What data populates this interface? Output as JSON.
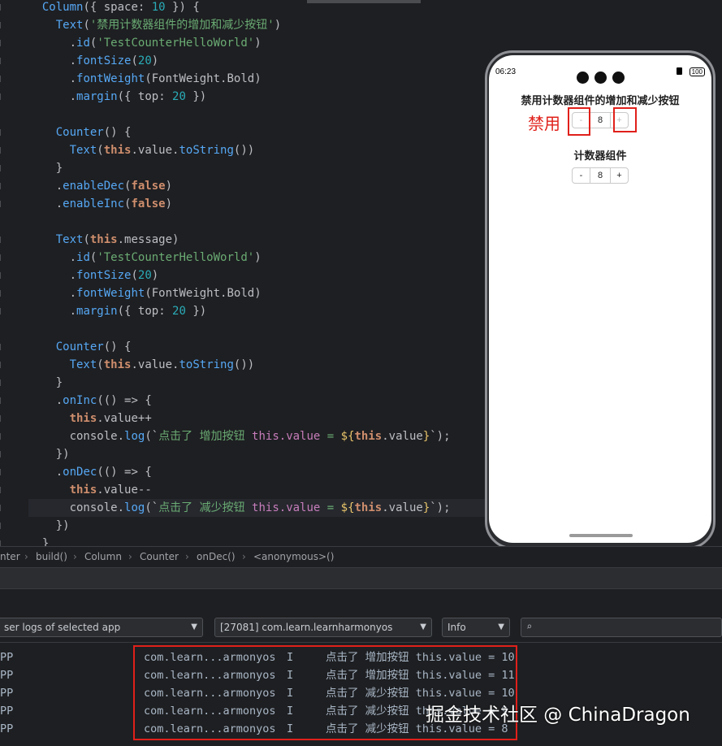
{
  "editor": {
    "lines": [
      {
        "tokens": [
          [
            "Column",
            "t-comp"
          ],
          [
            "({ ",
            "t-pn"
          ],
          [
            "space",
            "t-plain"
          ],
          [
            ": ",
            "t-pn"
          ],
          [
            "10",
            "t-num"
          ],
          [
            " }) {",
            "t-pn"
          ]
        ],
        "indent": "  "
      },
      {
        "tokens": [
          [
            "Text",
            "t-comp"
          ],
          [
            "(",
            "t-pn"
          ],
          [
            "'禁用计数器组件的增加和减少按钮'",
            "t-str"
          ],
          [
            ")",
            "t-pn"
          ]
        ],
        "indent": "    "
      },
      {
        "tokens": [
          [
            ".",
            "t-pn"
          ],
          [
            "id",
            "t-fn"
          ],
          [
            "(",
            "t-pn"
          ],
          [
            "'TestCounterHelloWorld'",
            "t-str"
          ],
          [
            ")",
            "t-pn"
          ]
        ],
        "indent": "      "
      },
      {
        "tokens": [
          [
            ".",
            "t-pn"
          ],
          [
            "fontSize",
            "t-fn"
          ],
          [
            "(",
            "t-pn"
          ],
          [
            "20",
            "t-num"
          ],
          [
            ")",
            "t-pn"
          ]
        ],
        "indent": "      "
      },
      {
        "tokens": [
          [
            ".",
            "t-pn"
          ],
          [
            "fontWeight",
            "t-fn"
          ],
          [
            "(",
            "t-pn"
          ],
          [
            "FontWeight",
            "t-plain"
          ],
          [
            ".",
            "t-pn"
          ],
          [
            "Bold",
            "t-plain"
          ],
          [
            ")",
            "t-pn"
          ]
        ],
        "indent": "      "
      },
      {
        "tokens": [
          [
            ".",
            "t-pn"
          ],
          [
            "margin",
            "t-fn"
          ],
          [
            "({ ",
            "t-pn"
          ],
          [
            "top",
            "t-plain"
          ],
          [
            ": ",
            "t-pn"
          ],
          [
            "20",
            "t-num"
          ],
          [
            " })",
            "t-pn"
          ]
        ],
        "indent": "      "
      },
      {
        "tokens": [],
        "indent": ""
      },
      {
        "tokens": [
          [
            "Counter",
            "t-comp"
          ],
          [
            "() {",
            "t-pn"
          ]
        ],
        "indent": "    "
      },
      {
        "tokens": [
          [
            "Text",
            "t-comp"
          ],
          [
            "(",
            "t-pn"
          ],
          [
            "this",
            "t-kw"
          ],
          [
            ".",
            "t-pn"
          ],
          [
            "value",
            "t-plain"
          ],
          [
            ".",
            "t-pn"
          ],
          [
            "toString",
            "t-fn"
          ],
          [
            "())",
            "t-pn"
          ]
        ],
        "indent": "      "
      },
      {
        "tokens": [
          [
            "}",
            "t-pn"
          ]
        ],
        "indent": "    "
      },
      {
        "tokens": [
          [
            ".",
            "t-pn"
          ],
          [
            "enableDec",
            "t-fn"
          ],
          [
            "(",
            "t-pn"
          ],
          [
            "false",
            "t-kw"
          ],
          [
            ")",
            "t-pn"
          ]
        ],
        "indent": "    "
      },
      {
        "tokens": [
          [
            ".",
            "t-pn"
          ],
          [
            "enableInc",
            "t-fn"
          ],
          [
            "(",
            "t-pn"
          ],
          [
            "false",
            "t-kw"
          ],
          [
            ")",
            "t-pn"
          ]
        ],
        "indent": "    "
      },
      {
        "tokens": [],
        "indent": ""
      },
      {
        "tokens": [
          [
            "Text",
            "t-comp"
          ],
          [
            "(",
            "t-pn"
          ],
          [
            "this",
            "t-kw"
          ],
          [
            ".",
            "t-pn"
          ],
          [
            "message",
            "t-plain"
          ],
          [
            ")",
            "t-pn"
          ]
        ],
        "indent": "    "
      },
      {
        "tokens": [
          [
            ".",
            "t-pn"
          ],
          [
            "id",
            "t-fn"
          ],
          [
            "(",
            "t-pn"
          ],
          [
            "'TestCounterHelloWorld'",
            "t-str"
          ],
          [
            ")",
            "t-pn"
          ]
        ],
        "indent": "      "
      },
      {
        "tokens": [
          [
            ".",
            "t-pn"
          ],
          [
            "fontSize",
            "t-fn"
          ],
          [
            "(",
            "t-pn"
          ],
          [
            "20",
            "t-num"
          ],
          [
            ")",
            "t-pn"
          ]
        ],
        "indent": "      "
      },
      {
        "tokens": [
          [
            ".",
            "t-pn"
          ],
          [
            "fontWeight",
            "t-fn"
          ],
          [
            "(",
            "t-pn"
          ],
          [
            "FontWeight",
            "t-plain"
          ],
          [
            ".",
            "t-pn"
          ],
          [
            "Bold",
            "t-plain"
          ],
          [
            ")",
            "t-pn"
          ]
        ],
        "indent": "      "
      },
      {
        "tokens": [
          [
            ".",
            "t-pn"
          ],
          [
            "margin",
            "t-fn"
          ],
          [
            "({ ",
            "t-pn"
          ],
          [
            "top",
            "t-plain"
          ],
          [
            ": ",
            "t-pn"
          ],
          [
            "20",
            "t-num"
          ],
          [
            " })",
            "t-pn"
          ]
        ],
        "indent": "      "
      },
      {
        "tokens": [],
        "indent": ""
      },
      {
        "tokens": [
          [
            "Counter",
            "t-comp"
          ],
          [
            "() {",
            "t-pn"
          ]
        ],
        "indent": "    "
      },
      {
        "tokens": [
          [
            "Text",
            "t-comp"
          ],
          [
            "(",
            "t-pn"
          ],
          [
            "this",
            "t-kw"
          ],
          [
            ".",
            "t-pn"
          ],
          [
            "value",
            "t-plain"
          ],
          [
            ".",
            "t-pn"
          ],
          [
            "toString",
            "t-fn"
          ],
          [
            "())",
            "t-pn"
          ]
        ],
        "indent": "      "
      },
      {
        "tokens": [
          [
            "}",
            "t-pn"
          ]
        ],
        "indent": "    "
      },
      {
        "tokens": [
          [
            ".",
            "t-pn"
          ],
          [
            "onInc",
            "t-fn"
          ],
          [
            "(() => {",
            "t-pn"
          ]
        ],
        "indent": "    "
      },
      {
        "tokens": [
          [
            "this",
            "t-kw"
          ],
          [
            ".",
            "t-pn"
          ],
          [
            "value",
            "t-plain"
          ],
          [
            "++",
            "t-pn"
          ]
        ],
        "indent": "      "
      },
      {
        "tokens": [
          [
            "console",
            "t-plain"
          ],
          [
            ".",
            "t-pn"
          ],
          [
            "log",
            "t-fn"
          ],
          [
            "(`",
            "t-pn"
          ],
          [
            "点击了 增加按钮 ",
            "t-str"
          ],
          [
            "this.value",
            "t-prop"
          ],
          [
            " = ",
            "t-str"
          ],
          [
            "${",
            "t-tpl"
          ],
          [
            "this",
            "t-kw"
          ],
          [
            ".",
            "t-pn"
          ],
          [
            "value",
            "t-plain"
          ],
          [
            "}",
            "t-tpl"
          ],
          [
            "`);",
            "t-pn"
          ]
        ],
        "indent": "      "
      },
      {
        "tokens": [
          [
            "})",
            "t-pn"
          ]
        ],
        "indent": "    "
      },
      {
        "tokens": [
          [
            ".",
            "t-pn"
          ],
          [
            "onDec",
            "t-fn"
          ],
          [
            "(() => {",
            "t-pn"
          ]
        ],
        "indent": "    "
      },
      {
        "tokens": [
          [
            "this",
            "t-kw"
          ],
          [
            ".",
            "t-pn"
          ],
          [
            "value",
            "t-plain"
          ],
          [
            "--",
            "t-pn"
          ]
        ],
        "indent": "      "
      },
      {
        "tokens": [
          [
            "console",
            "t-plain"
          ],
          [
            ".",
            "t-pn"
          ],
          [
            "log",
            "t-fn"
          ],
          [
            "(`",
            "t-pn"
          ],
          [
            "点击了 减少按钮 ",
            "t-str"
          ],
          [
            "this.value",
            "t-prop"
          ],
          [
            " = ",
            "t-str"
          ],
          [
            "${",
            "t-tpl"
          ],
          [
            "this",
            "t-kw"
          ],
          [
            ".",
            "t-pn"
          ],
          [
            "value",
            "t-plain"
          ],
          [
            "}",
            "t-tpl"
          ],
          [
            "`);",
            "t-pn"
          ]
        ],
        "indent": "      ",
        "active": true
      },
      {
        "tokens": [
          [
            "})",
            "t-pn"
          ]
        ],
        "indent": "    "
      },
      {
        "tokens": [
          [
            "}",
            "t-pn"
          ]
        ],
        "indent": "  "
      }
    ]
  },
  "phone": {
    "time": "06:23",
    "battery": "100",
    "title1": "禁用计数器组件的增加和减少按钮",
    "counter1": {
      "dec": "-",
      "value": "8",
      "inc": "+"
    },
    "title2": "计数器组件",
    "counter2": {
      "dec": "-",
      "value": "8",
      "inc": "+"
    },
    "annotation": "禁用"
  },
  "breadcrumb": [
    "nter",
    "build()",
    "Column",
    "Counter",
    "onDec()",
    "<anonymous>()"
  ],
  "logcat": {
    "filter_select": "ser logs of selected app",
    "process_select": "[27081] com.learn.learnharmonyos",
    "level_select": "Info",
    "search_placeholder": "",
    "rows": [
      {
        "app": "PP",
        "pkg": "com.learn...armonyos",
        "level": "I",
        "msg": "点击了 增加按钮 this.value = 10"
      },
      {
        "app": "PP",
        "pkg": "com.learn...armonyos",
        "level": "I",
        "msg": "点击了 增加按钮 this.value = 11"
      },
      {
        "app": "PP",
        "pkg": "com.learn...armonyos",
        "level": "I",
        "msg": "点击了 减少按钮 this.value = 10"
      },
      {
        "app": "PP",
        "pkg": "com.learn...armonyos",
        "level": "I",
        "msg": "点击了 减少按钮 this.value = 9"
      },
      {
        "app": "PP",
        "pkg": "com.learn...armonyos",
        "level": "I",
        "msg": "点击了 减少按钮 this.value = 8"
      }
    ]
  },
  "watermark": "掘金技术社区 @ ChinaDragon"
}
